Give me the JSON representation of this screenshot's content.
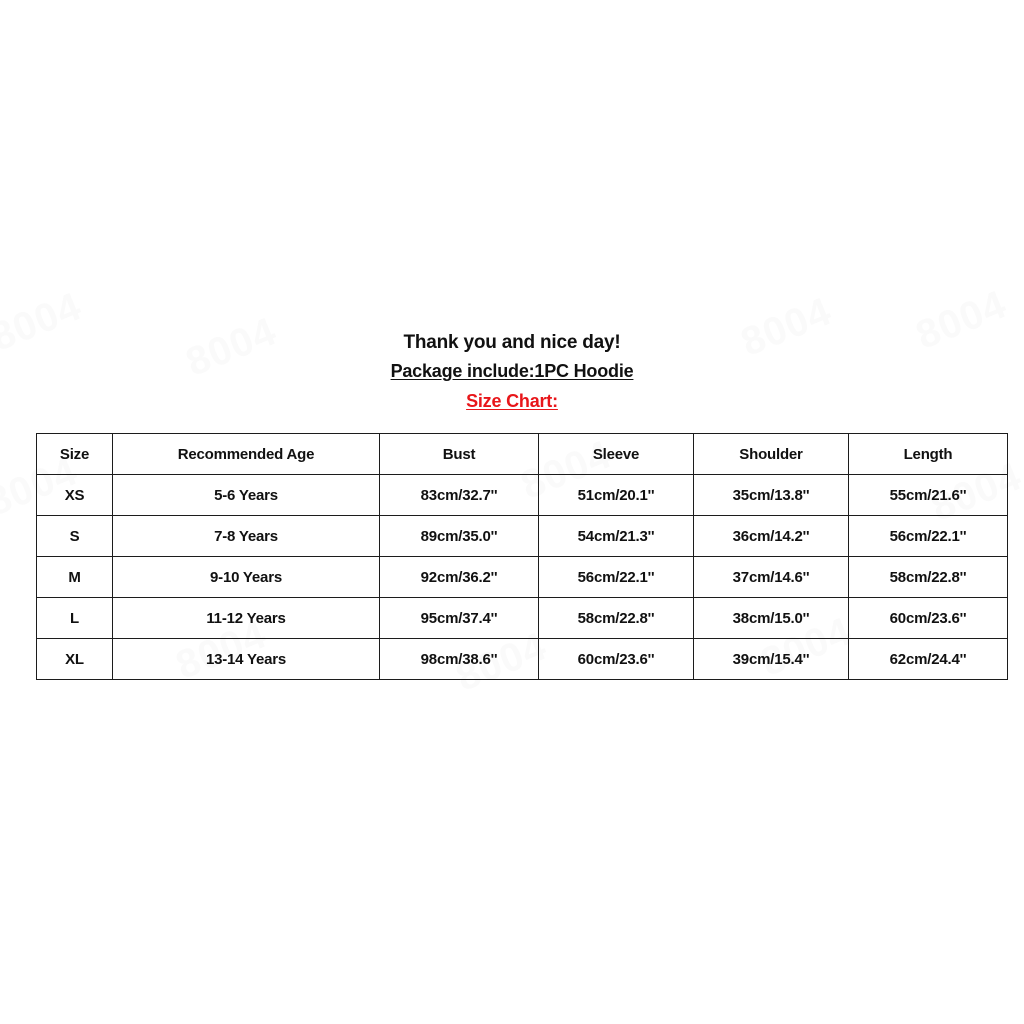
{
  "page": {
    "background_color": "#ffffff",
    "watermark_text": "8004"
  },
  "heading": {
    "thanks_line": "Thank you and nice day!",
    "package_line": "Package include:1PC Hoodie",
    "size_chart_label": "Size Chart:",
    "size_chart_color": "#e8161a",
    "text_color": "#111111"
  },
  "table": {
    "border_color": "#1c1c1c",
    "columns": [
      "Size",
      "Recommended Age",
      "Bust",
      "Sleeve",
      "Shoulder",
      "Length"
    ],
    "rows": [
      {
        "size": "XS",
        "age": "5-6 Years",
        "bust": "83cm/32.7''",
        "sleeve": "51cm/20.1''",
        "shoulder": "35cm/13.8''",
        "length": "55cm/21.6''"
      },
      {
        "size": "S",
        "age": "7-8 Years",
        "bust": "89cm/35.0''",
        "sleeve": "54cm/21.3''",
        "shoulder": "36cm/14.2''",
        "length": "56cm/22.1''"
      },
      {
        "size": "M",
        "age": "9-10 Years",
        "bust": "92cm/36.2''",
        "sleeve": "56cm/22.1''",
        "shoulder": "37cm/14.6''",
        "length": "58cm/22.8''"
      },
      {
        "size": "L",
        "age": "11-12 Years",
        "bust": "95cm/37.4''",
        "sleeve": "58cm/22.8''",
        "shoulder": "38cm/15.0''",
        "length": "60cm/23.6''"
      },
      {
        "size": "XL",
        "age": "13-14 Years",
        "bust": "98cm/38.6''",
        "sleeve": "60cm/23.6''",
        "shoulder": "39cm/15.4''",
        "length": "62cm/24.4''"
      }
    ]
  }
}
